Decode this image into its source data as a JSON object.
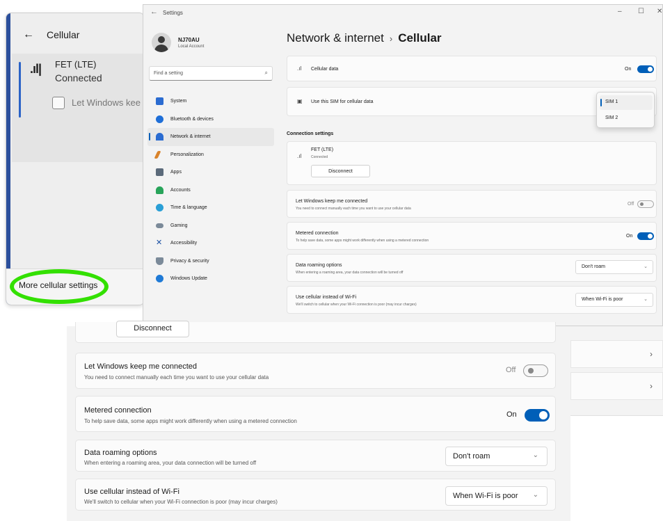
{
  "flyout": {
    "back_icon": "arrow-left-icon",
    "title": "Cellular",
    "network_name": "FET (LTE)",
    "network_status": "Connected",
    "keep_connected_label": "Let Windows kee",
    "more_settings": "More cellular settings"
  },
  "window": {
    "title": "Settings",
    "controls": [
      "–",
      "☐",
      "✕"
    ],
    "profile": {
      "name": "NJ70AU",
      "account": "Local Account"
    },
    "search_placeholder": "Find a setting",
    "nav": [
      {
        "label": "System",
        "icon": "monitor-icon",
        "color": "#2b6cd1"
      },
      {
        "label": "Bluetooth & devices",
        "icon": "bluetooth-icon",
        "color": "#1f6fd8"
      },
      {
        "label": "Network & internet",
        "icon": "wifi-icon",
        "color": "#2b6cd1",
        "active": true
      },
      {
        "label": "Personalization",
        "icon": "brush-icon",
        "color": "#d9832b"
      },
      {
        "label": "Apps",
        "icon": "apps-icon",
        "color": "#5b6a7a"
      },
      {
        "label": "Accounts",
        "icon": "person-icon",
        "color": "#28a45a"
      },
      {
        "label": "Time & language",
        "icon": "globe-clock-icon",
        "color": "#2a9fd6"
      },
      {
        "label": "Gaming",
        "icon": "gamepad-icon",
        "color": "#7b8a99"
      },
      {
        "label": "Accessibility",
        "icon": "accessibility-icon",
        "color": "#1a4fa3"
      },
      {
        "label": "Privacy & security",
        "icon": "shield-icon",
        "color": "#7b8a99"
      },
      {
        "label": "Windows Update",
        "icon": "update-icon",
        "color": "#1f7ad6"
      }
    ],
    "breadcrumb_parent": "Network & internet",
    "breadcrumb_separator": "›",
    "breadcrumb_current": "Cellular",
    "cellular_data": {
      "label": "Cellular data",
      "state": "On"
    },
    "sim_select": {
      "label": "Use this SIM for cellular data",
      "options": [
        "SIM 1",
        "SIM 2"
      ],
      "selected": "SIM 1"
    },
    "connection_settings_title": "Connection settings",
    "connection": {
      "name": "FET (LTE)",
      "status": "Connected",
      "button": "Disconnect"
    },
    "keep_connected": {
      "label": "Let Windows keep me connected",
      "sub": "You need to connect manually each time you want to use your cellular data",
      "state": "Off"
    },
    "metered": {
      "label": "Metered connection",
      "sub": "To help save data, some apps might work differently when using a metered connection",
      "state": "On"
    },
    "roaming": {
      "label": "Data roaming options",
      "sub": "When entering a roaming area, your data connection will be turned off",
      "value": "Don't roam"
    },
    "wifi_fallback": {
      "label": "Use cellular instead of Wi-Fi",
      "sub": "We'll switch to cellular when your Wi-Fi connection is poor (may incur charges)",
      "value": "When Wi-Fi is poor"
    }
  },
  "zoom": {
    "disconnect": "Disconnect",
    "keep_connected": {
      "label": "Let Windows keep me connected",
      "sub": "You need to connect manually each time you want to use your cellular data",
      "state": "Off"
    },
    "metered": {
      "label": "Metered connection",
      "sub": "To help save data, some apps might work differently when using a metered connection",
      "state": "On"
    },
    "roaming": {
      "label": "Data roaming options",
      "sub": "When entering a roaming area, your data connection will be turned off",
      "value": "Don't roam"
    },
    "wifi_fallback": {
      "label": "Use cellular instead of Wi-Fi",
      "sub": "We'll switch to cellular when your Wi-Fi connection is poor (may incur charges)",
      "value": "When Wi-Fi is poor"
    },
    "chevron": "›"
  },
  "colors": {
    "accent": "#005fb8",
    "highlight": "#33e000"
  }
}
